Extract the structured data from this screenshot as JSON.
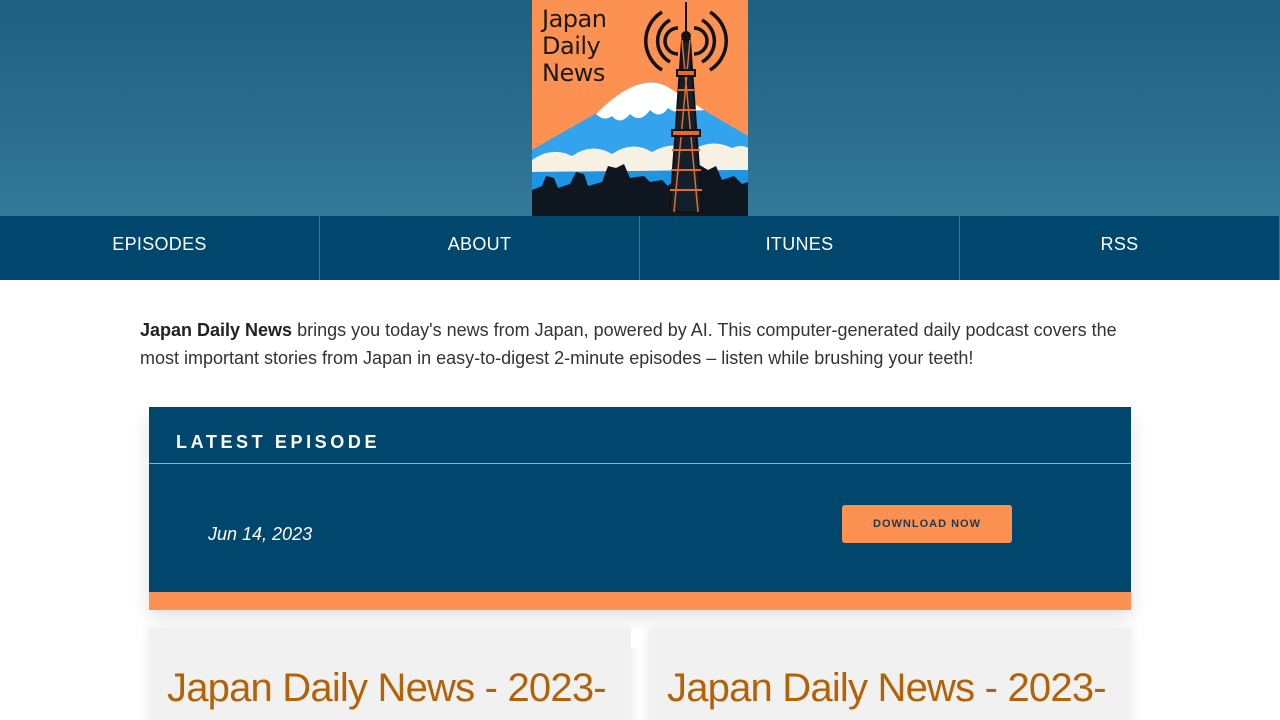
{
  "logo": {
    "lines": [
      "Japan",
      "Daily",
      "News"
    ],
    "icons": [
      "broadcast-tower-icon",
      "mount-fuji-icon",
      "radio-waves-icon"
    ]
  },
  "nav": {
    "items": [
      {
        "label": "EPISODES"
      },
      {
        "label": "ABOUT"
      },
      {
        "label": "ITUNES"
      },
      {
        "label": "RSS"
      }
    ]
  },
  "intro": {
    "brand": "Japan Daily News",
    "text": " brings you today's news from Japan, powered by AI. This computer-generated daily podcast covers the most important stories from Japan in easy-to-digest 2-minute episodes – listen while brushing your teeth!"
  },
  "latest": {
    "heading": "LATEST EPISODE",
    "date": "Jun 14, 2023",
    "download_label": "DOWNLOAD NOW"
  },
  "episodes": [
    {
      "title": "Japan Daily News - 2023-"
    },
    {
      "title": "Japan Daily News - 2023-"
    }
  ],
  "colors": {
    "header_bg": "#2a6c8e",
    "nav_bg": "#01476d",
    "accent_orange": "#fd9151",
    "episode_title": "#b36207"
  }
}
